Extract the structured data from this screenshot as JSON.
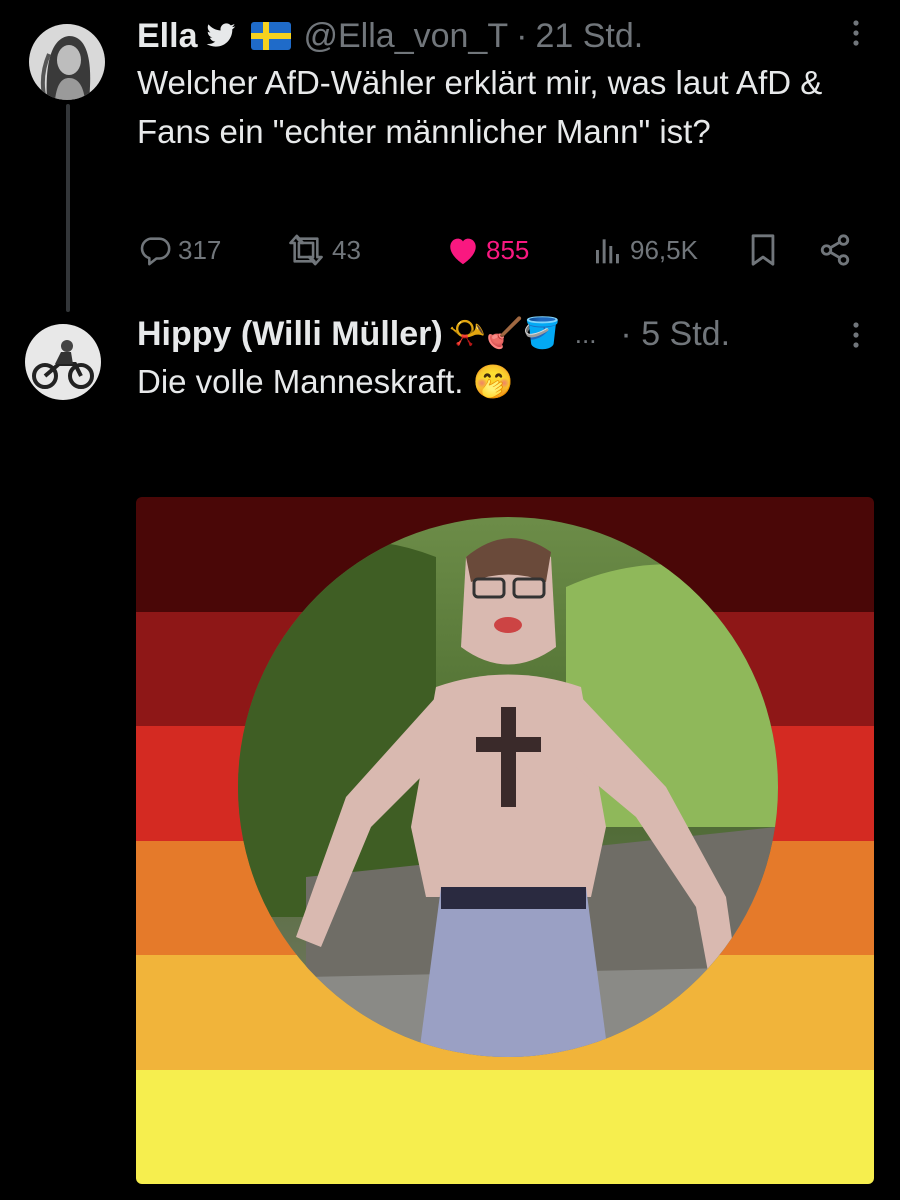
{
  "tweet": {
    "name": "Ella",
    "badges": [
      "bird-icon",
      "sweden-flag-icon"
    ],
    "handle": "@Ella_von_T",
    "separator": "·",
    "time": "21 Std.",
    "menu": "⋮",
    "text": "Welcher AfD-Wähler erklärt mir, was laut AfD & Fans ein \"echter männlicher Mann\" ist?",
    "stats": {
      "replies": "317",
      "retweets": "43",
      "likes": "855",
      "views": "96,5K"
    }
  },
  "reply": {
    "name": "Hippy (Willi Müller)",
    "emojis": "📯🪠🪣",
    "ellipsis": "...",
    "time": "· 5 Std.",
    "menu": "⋮",
    "text": "Die volle Manneskraft. 🤭"
  },
  "media": {
    "stripe_colors": [
      "#4a0707",
      "#8e1717",
      "#d42a22",
      "#e57a2a",
      "#f1b43a",
      "#f6ee4e"
    ]
  }
}
